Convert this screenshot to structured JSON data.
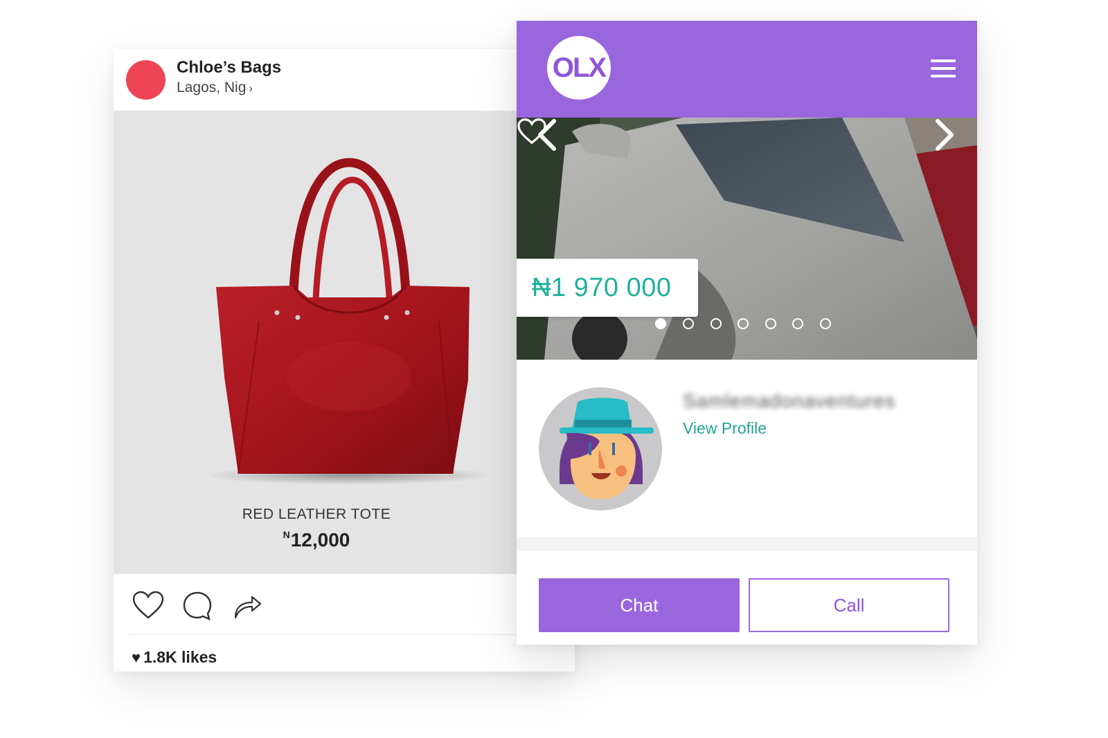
{
  "instagram_post": {
    "account_name": "Chloe’s Bags",
    "location": "Lagos, Nig",
    "location_chevron": "›",
    "product": {
      "name": "RED LEATHER TOTE",
      "currency_symbol": "N",
      "price": "12,000"
    },
    "actions": [
      "heart-icon",
      "comment-icon",
      "share-icon"
    ],
    "likes": "1.8K likes",
    "colors": {
      "avatar": "#ee4455",
      "bag": "#a5141c"
    }
  },
  "olx_listing": {
    "logo_text": "OLX",
    "price": "₦1 970 000",
    "carousel": {
      "image_count": 7,
      "active_index": 0
    },
    "seller": {
      "name": "Samlemadonaventures",
      "view_profile_label": "View Profile"
    },
    "buttons": {
      "chat_label": "Chat",
      "call_label": "Call"
    },
    "colors": {
      "brand": "#9966dd",
      "accent": "#20b09a"
    }
  }
}
